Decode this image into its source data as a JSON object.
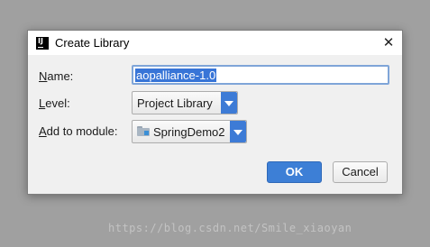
{
  "dialog": {
    "title": "Create Library",
    "app_icon_text": "IJ",
    "close_glyph": "✕"
  },
  "form": {
    "name_label_key": "N",
    "name_label_rest": "ame:",
    "name_value": "aopalliance-1.0",
    "level_label_key": "L",
    "level_label_rest": "evel:",
    "level_value": "Project Library",
    "module_label_key": "A",
    "module_label_rest": "dd to module:",
    "module_value": "SpringDemo2"
  },
  "buttons": {
    "ok": "OK",
    "cancel": "Cancel"
  },
  "watermark": "https://blog.csdn.net/Smile_xiaoyan",
  "colors": {
    "accent": "#3d7fd6",
    "selection": "#3875d7"
  }
}
